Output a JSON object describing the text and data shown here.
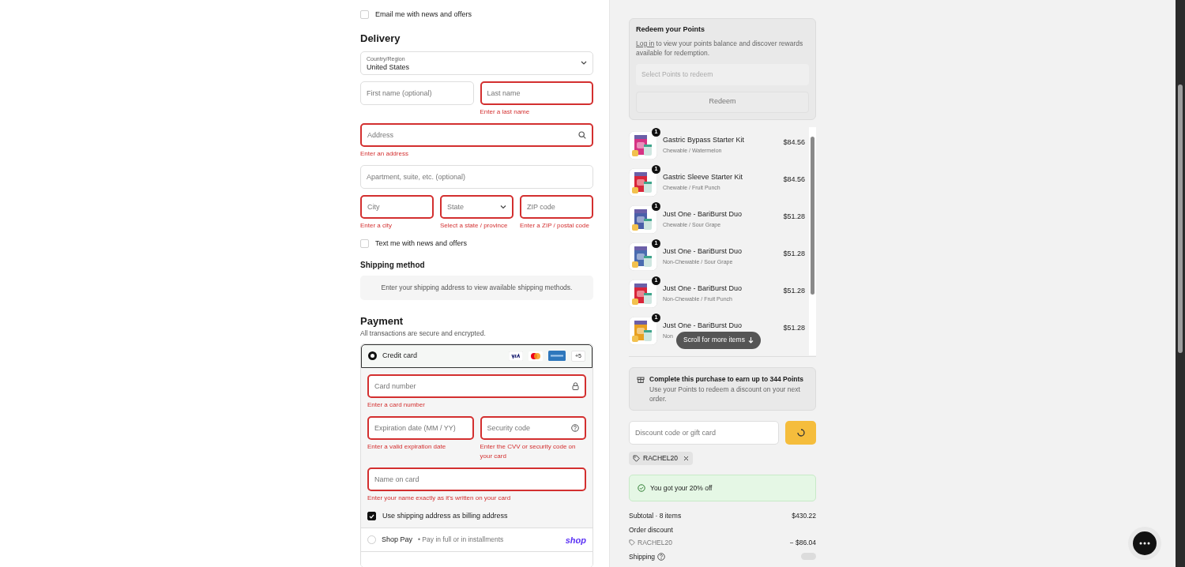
{
  "contact": {
    "newsletter": {
      "label": "Email me with news and offers",
      "checked": false
    }
  },
  "delivery": {
    "title": "Delivery",
    "country": {
      "label": "Country/Region",
      "value": "United States"
    },
    "rows": [
      [
        {
          "kind": "text",
          "placeholder": "First name (optional)",
          "error": false
        },
        {
          "kind": "text",
          "placeholder": "Last name",
          "error": true,
          "message": "Enter a last name"
        }
      ],
      [
        {
          "kind": "search",
          "placeholder": "Address",
          "error": true,
          "message": "Enter an address"
        }
      ],
      [
        {
          "kind": "text",
          "placeholder": "Apartment, suite, etc. (optional)",
          "error": false
        }
      ],
      [
        {
          "kind": "text",
          "placeholder": "City",
          "error": true,
          "message": "Enter a city"
        },
        {
          "kind": "select",
          "placeholder": "State",
          "error": true,
          "message": "Select a state / province"
        },
        {
          "kind": "text",
          "placeholder": "ZIP code",
          "error": true,
          "message": "Enter a ZIP / postal code"
        }
      ]
    ],
    "sms": {
      "label": "Text me with news and offers",
      "checked": false
    }
  },
  "shipping": {
    "title": "Shipping method",
    "notice": "Enter your shipping address to view available shipping methods."
  },
  "payment": {
    "title": "Payment",
    "subtitle": "All transactions are secure and encrypted.",
    "methods": [
      {
        "kind": "card",
        "label": "Credit card",
        "selected": true,
        "more": "+5"
      },
      {
        "kind": "shoppay",
        "label": "Shop Pay",
        "note": "• Pay in full or in installments",
        "logo_text": "shop",
        "selected": false
      }
    ],
    "card_fields": [
      [
        {
          "kind": "secure",
          "placeholder": "Card number",
          "error": true,
          "message": "Enter a card number"
        }
      ],
      [
        {
          "kind": "text",
          "placeholder": "Expiration date (MM / YY)",
          "error": true,
          "message": "Enter a valid expiration date"
        },
        {
          "kind": "help",
          "placeholder": "Security code",
          "error": true,
          "message": "Enter the CVV or security code on your card"
        }
      ],
      [
        {
          "kind": "text",
          "placeholder": "Name on card",
          "error": true,
          "message": "Enter your name exactly as it's written on your card"
        }
      ]
    ],
    "billing_same": {
      "label": "Use shipping address as billing address",
      "checked": true
    }
  },
  "points": {
    "title": "Redeem your Points",
    "link": "Log in",
    "text": "to view your points balance and discover rewards available for redemption.",
    "select_placeholder": "Select Points to redeem",
    "button": "Redeem",
    "disabled": true
  },
  "items": [
    {
      "name": "Gastric Bypass Starter Kit",
      "variant": "Chewable / Watermelon",
      "price": "$84.56",
      "quantity": "1"
    },
    {
      "name": "Gastric Sleeve Starter Kit",
      "variant": "Chewable / Fruit Punch",
      "price": "$84.56",
      "quantity": "1"
    },
    {
      "name": "Just One - BariBurst Duo",
      "variant": "Chewable / Sour Grape",
      "price": "$51.28",
      "quantity": "1"
    },
    {
      "name": "Just One - BariBurst Duo",
      "variant": "Non-Chewable / Sour Grape",
      "price": "$51.28",
      "quantity": "1"
    },
    {
      "name": "Just One - BariBurst Duo",
      "variant": "Non-Chewable / Fruit Punch",
      "price": "$51.28",
      "quantity": "1"
    },
    {
      "name": "Just One - BariBurst Duo",
      "variant": "Non",
      "price": "$51.28",
      "quantity": "1"
    }
  ],
  "scroll_hint": "Scroll for more items",
  "earn": {
    "title": "Complete this purchase to earn up to 344 Points",
    "text": "Use your Points to redeem a discount on your next order."
  },
  "discount": {
    "placeholder": "Discount code or gift card",
    "loading": true,
    "applied_code": "RACHEL20",
    "success": "You got your 20% off"
  },
  "summary": {
    "subtotal_label": "Subtotal · 8 items",
    "subtotal": "$430.22",
    "discount_label": "Order discount",
    "discount_code": "RACHEL20",
    "discount_amount": "− $86.04",
    "shipping_label": "Shipping",
    "shipping_loading": true
  }
}
